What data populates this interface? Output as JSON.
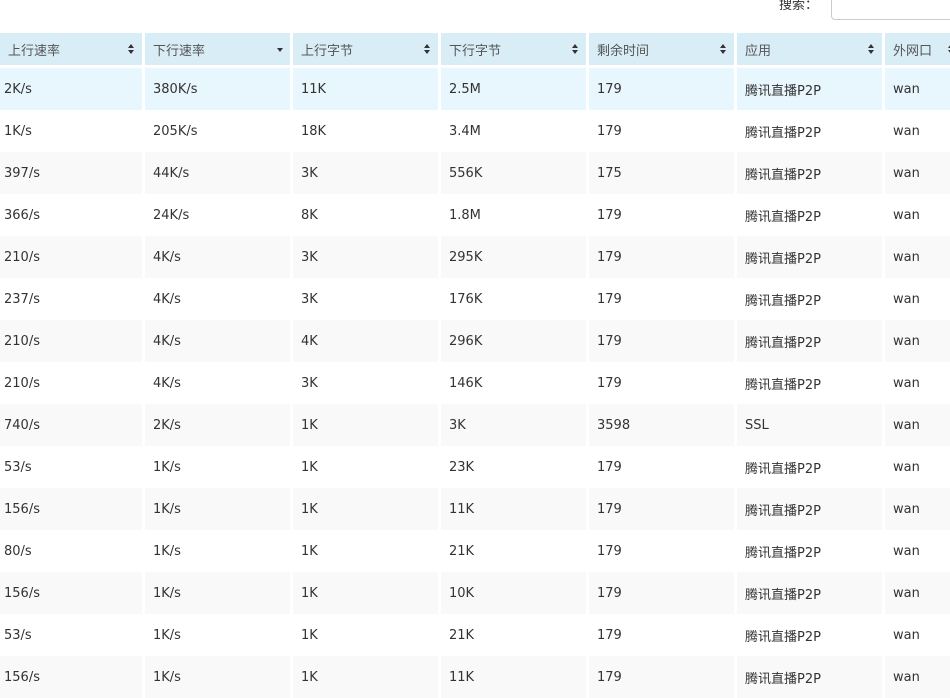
{
  "search": {
    "label": "搜索：",
    "value": "",
    "placeholder": ""
  },
  "table": {
    "columns": [
      {
        "label": "上行速率",
        "sort": "both"
      },
      {
        "label": "下行速率",
        "sort": "desc"
      },
      {
        "label": "上行字节",
        "sort": "both"
      },
      {
        "label": "下行字节",
        "sort": "both"
      },
      {
        "label": "剩余时间",
        "sort": "both"
      },
      {
        "label": "应用",
        "sort": "both"
      },
      {
        "label": "外网口",
        "sort": "both"
      }
    ],
    "rows": [
      [
        "2K/s",
        "380K/s",
        "11K",
        "2.5M",
        "179",
        "腾讯直播P2P",
        "wan"
      ],
      [
        "1K/s",
        "205K/s",
        "18K",
        "3.4M",
        "179",
        "腾讯直播P2P",
        "wan"
      ],
      [
        "397/s",
        "44K/s",
        "3K",
        "556K",
        "175",
        "腾讯直播P2P",
        "wan"
      ],
      [
        "366/s",
        "24K/s",
        "8K",
        "1.8M",
        "179",
        "腾讯直播P2P",
        "wan"
      ],
      [
        "210/s",
        "4K/s",
        "3K",
        "295K",
        "179",
        "腾讯直播P2P",
        "wan"
      ],
      [
        "237/s",
        "4K/s",
        "3K",
        "176K",
        "179",
        "腾讯直播P2P",
        "wan"
      ],
      [
        "210/s",
        "4K/s",
        "4K",
        "296K",
        "179",
        "腾讯直播P2P",
        "wan"
      ],
      [
        "210/s",
        "4K/s",
        "3K",
        "146K",
        "179",
        "腾讯直播P2P",
        "wan"
      ],
      [
        "740/s",
        "2K/s",
        "1K",
        "3K",
        "3598",
        "SSL",
        "wan"
      ],
      [
        "53/s",
        "1K/s",
        "1K",
        "23K",
        "179",
        "腾讯直播P2P",
        "wan"
      ],
      [
        "156/s",
        "1K/s",
        "1K",
        "11K",
        "179",
        "腾讯直播P2P",
        "wan"
      ],
      [
        "80/s",
        "1K/s",
        "1K",
        "21K",
        "179",
        "腾讯直播P2P",
        "wan"
      ],
      [
        "156/s",
        "1K/s",
        "1K",
        "10K",
        "179",
        "腾讯直播P2P",
        "wan"
      ],
      [
        "53/s",
        "1K/s",
        "1K",
        "21K",
        "179",
        "腾讯直播P2P",
        "wan"
      ],
      [
        "156/s",
        "1K/s",
        "1K",
        "11K",
        "179",
        "腾讯直播P2P",
        "wan"
      ]
    ],
    "selected_row": 0
  },
  "colors": {
    "header_bg": "#d9edf7",
    "selected_row_bg": "#e8f6fd",
    "striped_row_bg": "#f9f9f9",
    "text": "#333333"
  }
}
